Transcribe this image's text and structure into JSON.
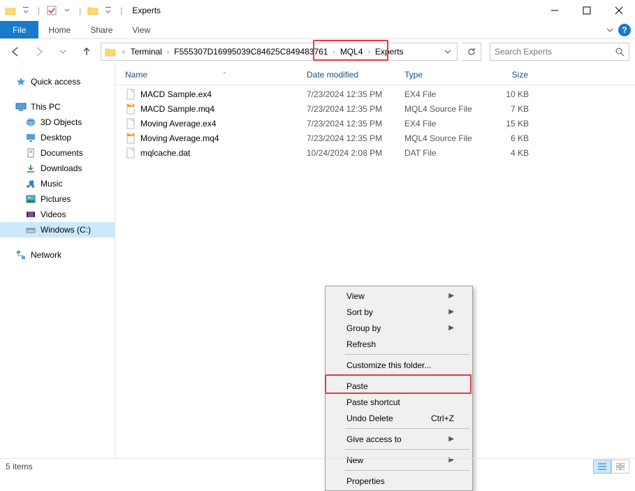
{
  "title": "Experts",
  "ribbon": {
    "file": "File",
    "tabs": [
      "Home",
      "Share",
      "View"
    ]
  },
  "breadcrumb": {
    "prefix": "«",
    "parts": [
      "Terminal",
      "F555307D16995039C84625C849483761",
      "MQL4",
      "Experts"
    ]
  },
  "search": {
    "placeholder": "Search Experts"
  },
  "sidebar": {
    "quick_access": "Quick access",
    "this_pc": "This PC",
    "pc_items": [
      "3D Objects",
      "Desktop",
      "Documents",
      "Downloads",
      "Music",
      "Pictures",
      "Videos",
      "Windows (C:)"
    ],
    "network": "Network"
  },
  "columns": {
    "name": "Name",
    "date": "Date modified",
    "type": "Type",
    "size": "Size"
  },
  "files": [
    {
      "name": "MACD Sample.ex4",
      "date": "7/23/2024 12:35 PM",
      "type": "EX4 File",
      "size": "10 KB",
      "kind": "ex4"
    },
    {
      "name": "MACD Sample.mq4",
      "date": "7/23/2024 12:35 PM",
      "type": "MQL4 Source File",
      "size": "7 KB",
      "kind": "mq4"
    },
    {
      "name": "Moving Average.ex4",
      "date": "7/23/2024 12:35 PM",
      "type": "EX4 File",
      "size": "15 KB",
      "kind": "ex4"
    },
    {
      "name": "Moving Average.mq4",
      "date": "7/23/2024 12:35 PM",
      "type": "MQL4 Source File",
      "size": "6 KB",
      "kind": "mq4"
    },
    {
      "name": "mqlcache.dat",
      "date": "10/24/2024 2:08 PM",
      "type": "DAT File",
      "size": "4 KB",
      "kind": "dat"
    }
  ],
  "context_menu": {
    "view": "View",
    "sort_by": "Sort by",
    "group_by": "Group by",
    "refresh": "Refresh",
    "customize": "Customize this folder...",
    "paste": "Paste",
    "paste_shortcut": "Paste shortcut",
    "undo_delete": "Undo Delete",
    "undo_shortcut": "Ctrl+Z",
    "give_access": "Give access to",
    "new": "New",
    "properties": "Properties"
  },
  "status": {
    "count": "5 items"
  }
}
